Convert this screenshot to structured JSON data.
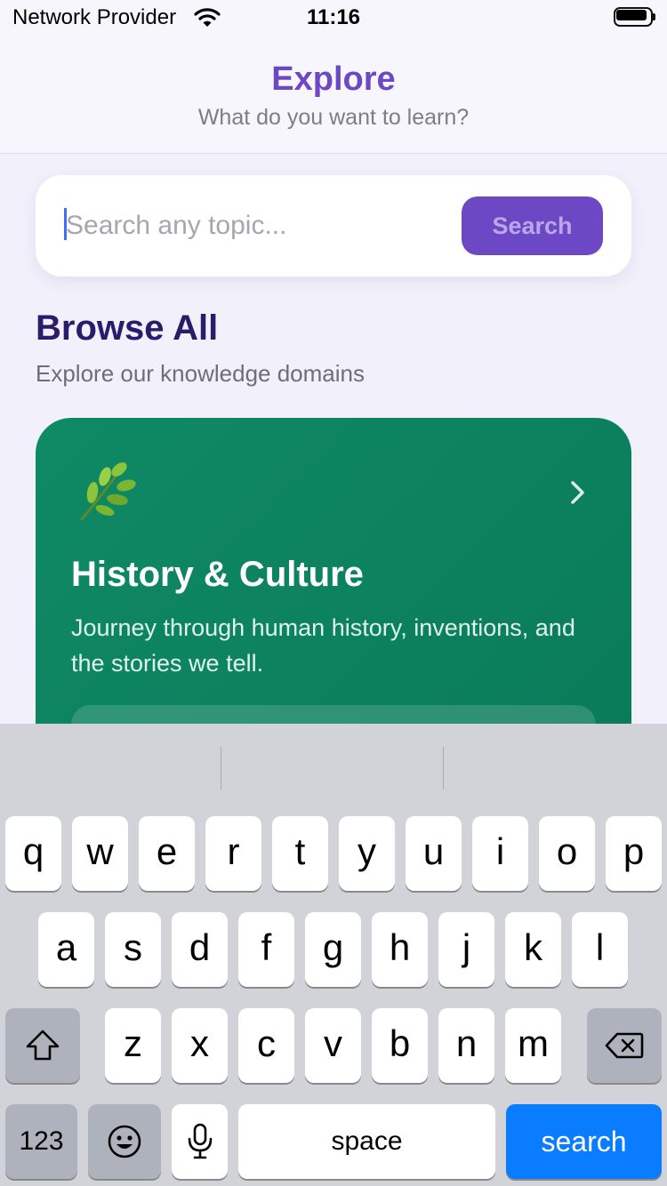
{
  "status_bar": {
    "carrier": "Network Provider",
    "time": "11:16"
  },
  "header": {
    "title": "Explore",
    "subtitle": "What do you want to learn?"
  },
  "search": {
    "placeholder": "Search any topic...",
    "value": "",
    "button_label": "Search"
  },
  "browse": {
    "title": "Browse All",
    "subtitle": "Explore our knowledge domains"
  },
  "domains": [
    {
      "icon": "herb-leaf-emoji",
      "title": "History & Culture",
      "description": "Journey through human history, inventions, and the stories we tell."
    }
  ],
  "keyboard": {
    "row1": [
      "q",
      "w",
      "e",
      "r",
      "t",
      "y",
      "u",
      "i",
      "o",
      "p"
    ],
    "row2": [
      "a",
      "s",
      "d",
      "f",
      "g",
      "h",
      "j",
      "k",
      "l"
    ],
    "row3": [
      "z",
      "x",
      "c",
      "v",
      "b",
      "n",
      "m"
    ],
    "numbers_label": "123",
    "space_label": "space",
    "action_label": "search"
  },
  "colors": {
    "accent": "#6d48c4",
    "heading": "#2a1c6b",
    "card_green": "#0f8a64",
    "keyboard_action": "#0a7cff"
  }
}
